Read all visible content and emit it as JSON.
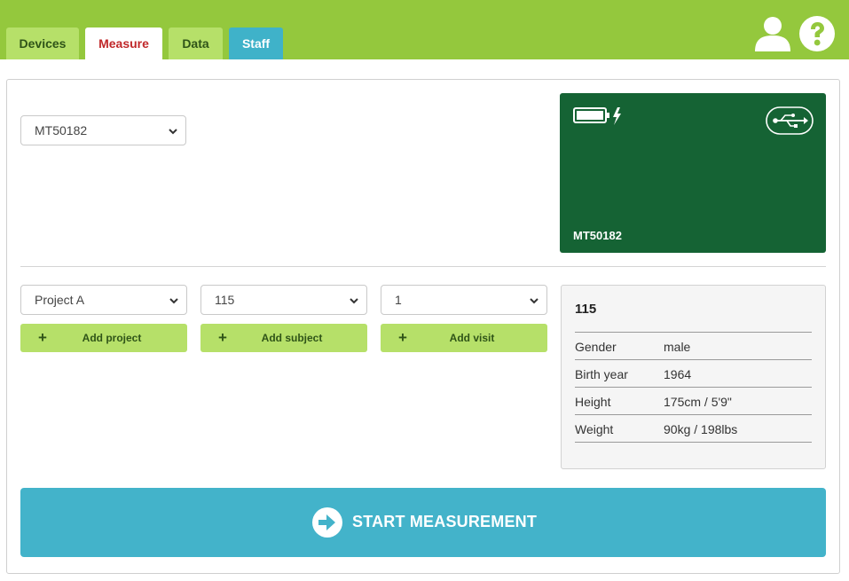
{
  "tabs": [
    {
      "label": "Devices"
    },
    {
      "label": "Measure",
      "active": true
    },
    {
      "label": "Data"
    },
    {
      "label": "Staff"
    }
  ],
  "header_icons": [
    "user-icon",
    "help-icon"
  ],
  "device_select": {
    "value": "MT50182"
  },
  "device_card": {
    "name": "MT50182",
    "icons": [
      "battery-charging-icon",
      "usb-icon"
    ]
  },
  "project_select": {
    "value": "Project A"
  },
  "subject_select": {
    "value": "115"
  },
  "visit_select": {
    "value": "1"
  },
  "buttons": {
    "add_project": "Add project",
    "add_subject": "Add subject",
    "add_visit": "Add visit",
    "start": "START MEASUREMENT"
  },
  "subject_info": {
    "title": "115",
    "rows": [
      {
        "label": "Gender",
        "value": "male"
      },
      {
        "label": "Birth year",
        "value": "1964"
      },
      {
        "label": "Height",
        "value": "175cm / 5'9\""
      },
      {
        "label": "Weight",
        "value": "90kg / 198lbs"
      }
    ]
  },
  "colors": {
    "top_bar": "#94c83d",
    "tab_green": "#b6e069",
    "tab_active_text": "#c0282a",
    "staff_tab": "#3fb2c9",
    "device_card": "#156334",
    "start_button": "#43b3ca"
  }
}
